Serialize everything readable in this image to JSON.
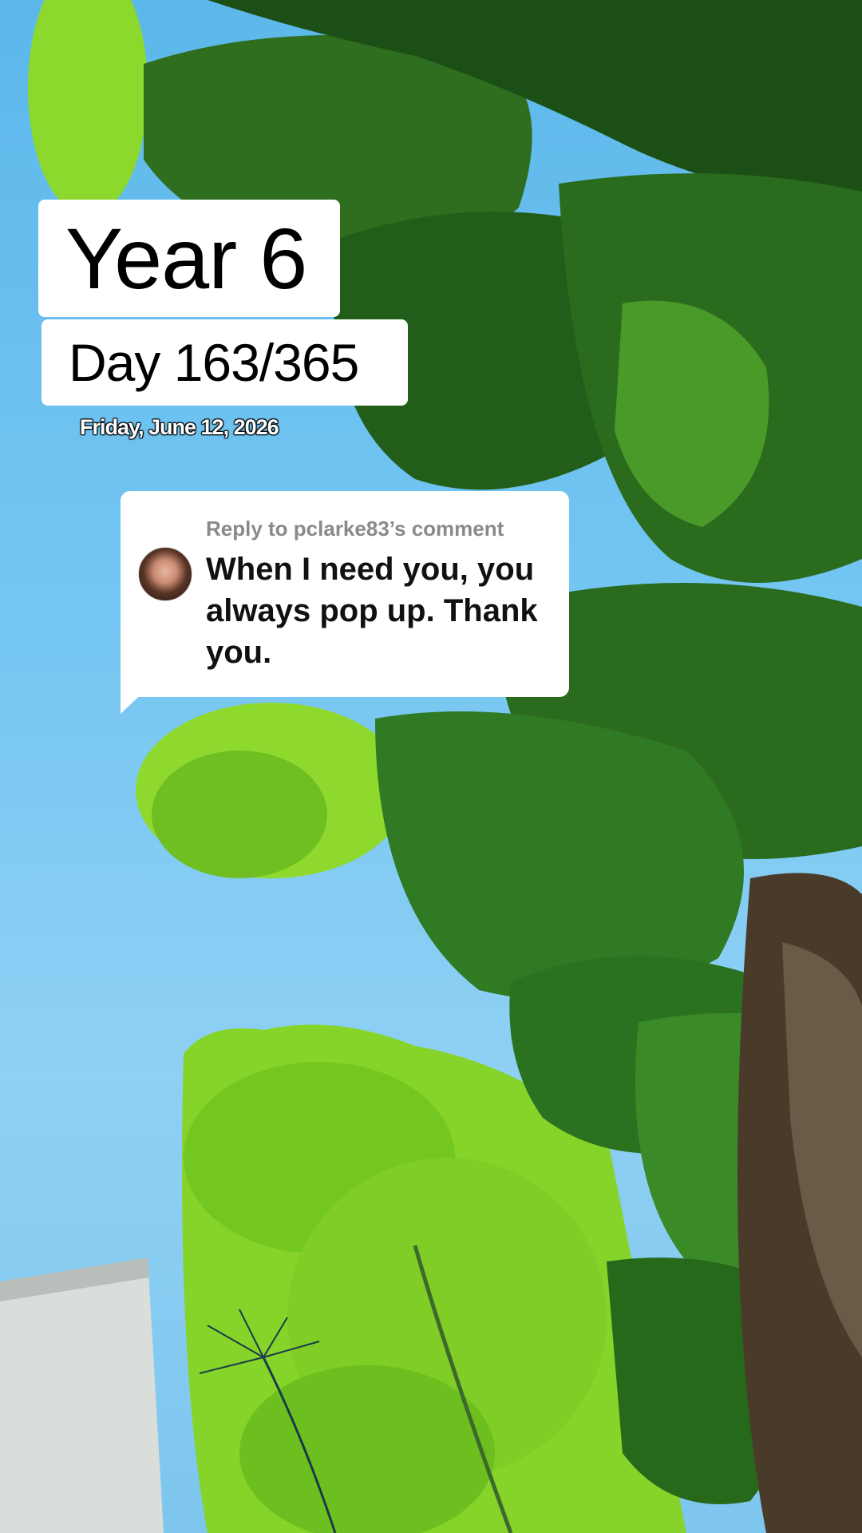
{
  "overlay": {
    "title": "Year 6",
    "day": "Day 163/365",
    "date": "Friday, June 12, 2026"
  },
  "reply": {
    "header": "Reply to pclarke83’s comment",
    "message": "When I need you, you always pop up. Thank you."
  },
  "colors": {
    "sky": "#74c6f2",
    "foliage_dark": "#1f5f1c",
    "foliage_light": "#7fcf2a"
  }
}
